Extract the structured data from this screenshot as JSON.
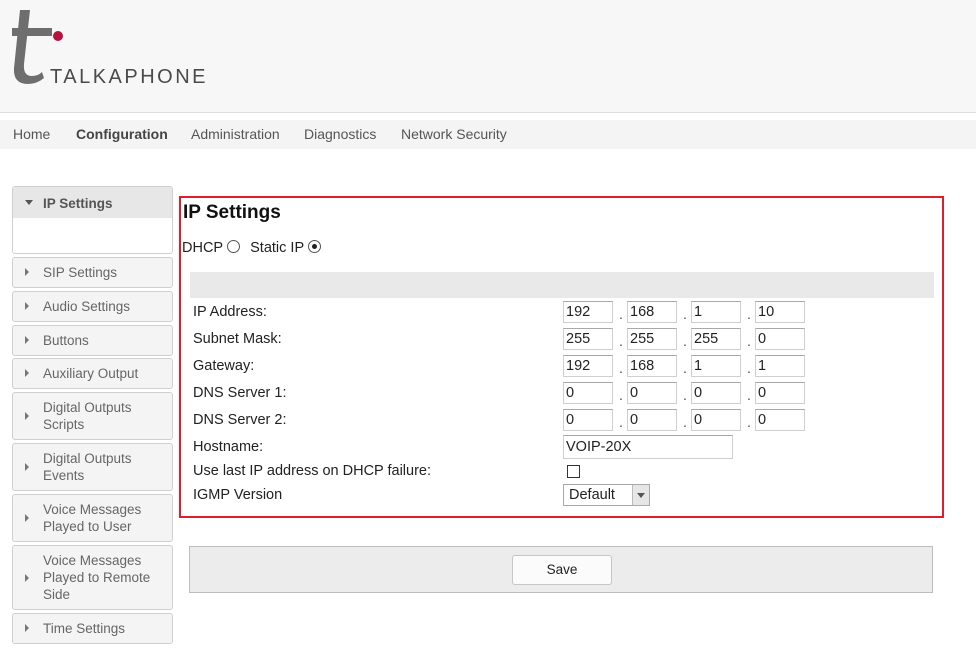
{
  "brand": {
    "name": "TALKAPHONE",
    "accent": "#b5123e",
    "logo_color": "#6e6e6e",
    "icon": "talkaphone-t-logo"
  },
  "nav": {
    "items": [
      "Home",
      "Configuration",
      "Administration",
      "Diagnostics",
      "Network Security"
    ],
    "active": "Configuration"
  },
  "sidebar": {
    "items": [
      {
        "label": "IP Settings",
        "open": true
      },
      {
        "label": "SIP Settings"
      },
      {
        "label": "Audio Settings"
      },
      {
        "label": "Buttons"
      },
      {
        "label": "Auxiliary Output"
      },
      {
        "label": "Digital Outputs Scripts"
      },
      {
        "label": "Digital Outputs Events"
      },
      {
        "label": "Voice Messages Played to User"
      },
      {
        "label": "Voice Messages Played to Remote Side"
      },
      {
        "label": "Time Settings"
      }
    ]
  },
  "panel": {
    "title": "IP Settings",
    "highlight_color": "#e01e2b",
    "mode": {
      "dhcp_label": "DHCP",
      "static_label": "Static IP",
      "selected": "Static IP"
    },
    "rows": {
      "ip_address": {
        "label": "IP Address:",
        "octets": [
          "192",
          "168",
          "1",
          "10"
        ]
      },
      "subnet_mask": {
        "label": "Subnet Mask:",
        "octets": [
          "255",
          "255",
          "255",
          "0"
        ]
      },
      "gateway": {
        "label": "Gateway:",
        "octets": [
          "192",
          "168",
          "1",
          "1"
        ]
      },
      "dns1": {
        "label": "DNS Server 1:",
        "octets": [
          "0",
          "0",
          "0",
          "0"
        ]
      },
      "dns2": {
        "label": "DNS Server 2:",
        "octets": [
          "0",
          "0",
          "0",
          "0"
        ]
      }
    },
    "separator": ".",
    "hostname": {
      "label": "Hostname:",
      "value": "VOIP-20X"
    },
    "dhcp_fallback": {
      "label": "Use last IP address on DHCP failure:",
      "checked": false
    },
    "igmp": {
      "label": "IGMP Version",
      "selected": "Default"
    }
  },
  "actions": {
    "save_label": "Save"
  }
}
